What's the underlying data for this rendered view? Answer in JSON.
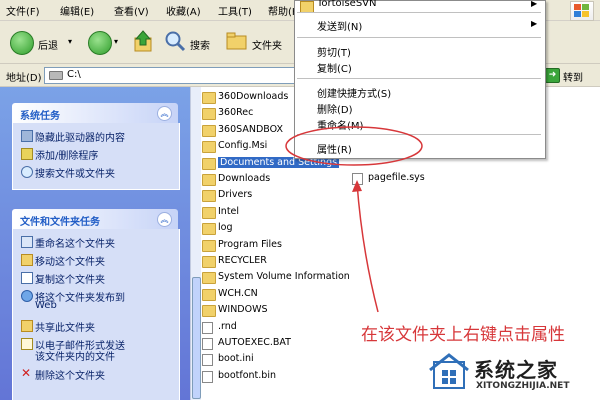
{
  "menubar": {
    "items": [
      "文件(F)",
      "编辑(E)",
      "查看(V)",
      "收藏(A)",
      "工具(T)",
      "帮助(H)"
    ]
  },
  "toolbar": {
    "back_label": "后退",
    "search_label": "搜索",
    "folders_label": "文件夹"
  },
  "address": {
    "label": "地址(D)",
    "value": "C:\\",
    "go_label": "转到"
  },
  "system_tasks": {
    "title": "系统任务",
    "items": [
      "隐藏此驱动器的内容",
      "添加/删除程序",
      "搜索文件或文件夹"
    ]
  },
  "file_tasks": {
    "title": "文件和文件夹任务",
    "items": [
      "重命名这个文件夹",
      "移动这个文件夹",
      "复制这个文件夹",
      "将这个文件夹发布到",
      "Web",
      "共享此文件夹",
      "以电子邮件形式发送",
      "该文件夹内的文件",
      "删除这个文件夹"
    ]
  },
  "files": [
    {
      "name": "360Downloads",
      "type": "folder"
    },
    {
      "name": "360Rec",
      "type": "folder"
    },
    {
      "name": "360SANDBOX",
      "type": "folder"
    },
    {
      "name": "Config.Msi",
      "type": "folder"
    },
    {
      "name": "Documents and Settings",
      "type": "folder",
      "selected": true
    },
    {
      "name": "Downloads",
      "type": "folder"
    },
    {
      "name": "Drivers",
      "type": "folder"
    },
    {
      "name": "Intel",
      "type": "folder"
    },
    {
      "name": "log",
      "type": "folder"
    },
    {
      "name": "Program Files",
      "type": "folder"
    },
    {
      "name": "RECYCLER",
      "type": "folder"
    },
    {
      "name": "System Volume Information",
      "type": "folder"
    },
    {
      "name": "WCH.CN",
      "type": "folder"
    },
    {
      "name": "WINDOWS",
      "type": "folder"
    },
    {
      "name": ".rnd",
      "type": "file"
    },
    {
      "name": "AUTOEXEC.BAT",
      "type": "file"
    },
    {
      "name": "boot.ini",
      "type": "file"
    },
    {
      "name": "bootfont.bin",
      "type": "file"
    }
  ],
  "files_right": [
    {
      "name": "pagefile.sys",
      "type": "file"
    }
  ],
  "context_menu": {
    "top_item": "TortoiseSVN",
    "send_to": "发送到(N)",
    "cut": "剪切(T)",
    "copy": "复制(C)",
    "create_shortcut": "创建快捷方式(S)",
    "delete": "删除(D)",
    "rename": "重命名(M)",
    "properties": "属性(R)"
  },
  "annotation": "在该文件夹上右键点击属性",
  "watermark": {
    "title": "系统之家",
    "url": "XITONGZHIJIA.NET"
  },
  "colors": {
    "left_pane_top": "#7ba2e7",
    "left_pane_bottom": "#6375d6",
    "annotation": "#d7373a",
    "selection": "#316ac5"
  }
}
